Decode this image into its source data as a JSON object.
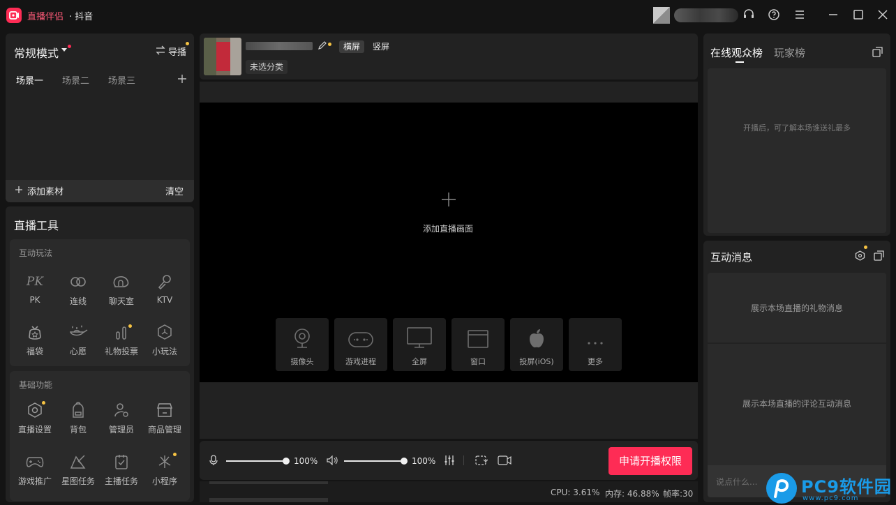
{
  "app": {
    "title": "直播伴侣",
    "platform": "· 抖音"
  },
  "mode": {
    "label": "常规模式",
    "guide_label": "导播"
  },
  "scenes": {
    "tabs": [
      "场景一",
      "场景二",
      "场景三"
    ],
    "add_source": "添加素材",
    "clear": "清空"
  },
  "tools": {
    "title": "直播工具",
    "interactive": {
      "title": "互动玩法",
      "items": [
        {
          "label": "PK",
          "icon": "pk-icon"
        },
        {
          "label": "连线",
          "icon": "link-icon"
        },
        {
          "label": "聊天室",
          "icon": "chatroom-icon"
        },
        {
          "label": "KTV",
          "icon": "microphone-icon"
        },
        {
          "label": "福袋",
          "icon": "lucky-bag-icon"
        },
        {
          "label": "心愿",
          "icon": "wish-lamp-icon"
        },
        {
          "label": "礼物投票",
          "icon": "vote-icon"
        },
        {
          "label": "小玩法",
          "icon": "mini-game-icon"
        }
      ]
    },
    "basic": {
      "title": "基础功能",
      "items": [
        {
          "label": "直播设置",
          "icon": "settings-icon"
        },
        {
          "label": "背包",
          "icon": "backpack-icon"
        },
        {
          "label": "管理员",
          "icon": "admin-icon"
        },
        {
          "label": "商品管理",
          "icon": "store-icon"
        },
        {
          "label": "游戏推广",
          "icon": "gamepad-icon"
        },
        {
          "label": "星图任务",
          "icon": "star-map-icon"
        },
        {
          "label": "主播任务",
          "icon": "task-icon"
        },
        {
          "label": "小程序",
          "icon": "mini-program-icon"
        }
      ]
    }
  },
  "stream": {
    "category": "未选分类",
    "orientation": [
      "横屏",
      "竖屏"
    ],
    "add_scene_label": "添加直播画面",
    "sources": [
      {
        "label": "摄像头",
        "icon": "camera-icon"
      },
      {
        "label": "游戏进程",
        "icon": "game-process-icon"
      },
      {
        "label": "全屏",
        "icon": "monitor-icon"
      },
      {
        "label": "窗口",
        "icon": "window-icon"
      },
      {
        "label": "投屏(iOS)",
        "icon": "apple-icon"
      },
      {
        "label": "更多",
        "icon": "more-icon"
      }
    ]
  },
  "audio": {
    "mic_volume": "100%",
    "speaker_volume": "100%",
    "mic_level": 1.0,
    "speaker_level": 1.0
  },
  "apply_button": "申请开播权限",
  "status": {
    "cpu": "CPU: 3.61%",
    "memory": "内存: 46.88%",
    "fps": "帧率:30"
  },
  "audience": {
    "tabs": [
      "在线观众榜",
      "玩家榜"
    ],
    "empty_text": "开播后，可了解本场谁送礼最多"
  },
  "messages": {
    "title": "互动消息",
    "gift_text": "展示本场直播的礼物消息",
    "comment_text": "展示本场直播的评论互动消息",
    "input_placeholder": "说点什么..."
  },
  "watermark": {
    "brand": "PC9软件园",
    "url": "www.pc9.com"
  },
  "colors": {
    "accent": "#fe2c55",
    "badge": "#f6c343"
  }
}
